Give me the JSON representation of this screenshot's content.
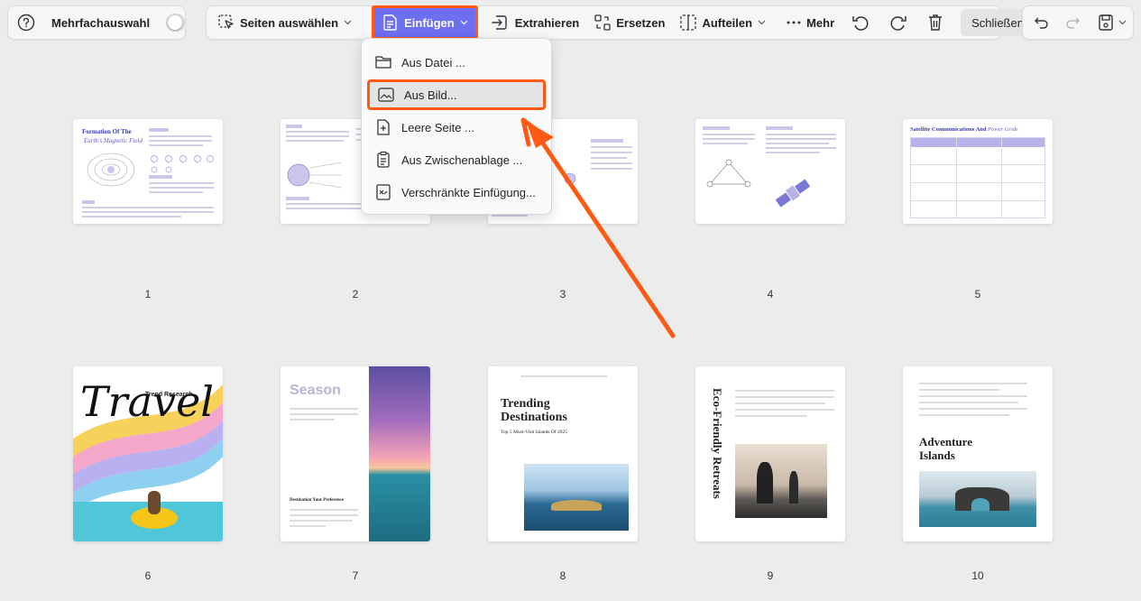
{
  "toolbar": {
    "help_icon": "help-circle-icon",
    "multiselect_label": "Mehrfachauswahl",
    "multiselect_on": false,
    "select_pages_label": "Seiten auswählen",
    "insert_label": "Einfügen",
    "extract_label": "Extrahieren",
    "replace_label": "Ersetzen",
    "split_label": "Aufteilen",
    "more_label": "Mehr",
    "close_label": "Schließen"
  },
  "insert_menu": {
    "items": [
      {
        "label": "Aus Datei ...",
        "icon": "folder-icon"
      },
      {
        "label": "Aus Bild...",
        "icon": "image-icon"
      },
      {
        "label": "Leere Seite ...",
        "icon": "blank-page-icon"
      },
      {
        "label": "Aus Zwischenablage ...",
        "icon": "clipboard-icon"
      },
      {
        "label": "Verschränkte Einfügung...",
        "icon": "interleave-icon"
      }
    ],
    "highlighted_index": 1
  },
  "pages": [
    {
      "number": "1",
      "title": "Formation Of The",
      "subtitle": "Earth's Magnetic Field"
    },
    {
      "number": "2"
    },
    {
      "number": "3"
    },
    {
      "number": "4"
    },
    {
      "number": "5",
      "title": "Satellite Communications And",
      "subtitle": "Power Grids"
    },
    {
      "number": "6",
      "title": "Travel",
      "subtitle": "Trend Research"
    },
    {
      "number": "7",
      "title": "Season",
      "subtitle": "Destination Your Preference"
    },
    {
      "number": "8",
      "title": "Trending Destinations",
      "subtitle": "Top 5 Must-Visit Islands Of 2025"
    },
    {
      "number": "9",
      "title": "Eco-Friendly Retreats"
    },
    {
      "number": "10",
      "title": "Adventure Islands"
    }
  ],
  "colors": {
    "accent": "#6e6ef0",
    "highlight_border": "#ff5a14",
    "arrow": "#ff5a14"
  }
}
